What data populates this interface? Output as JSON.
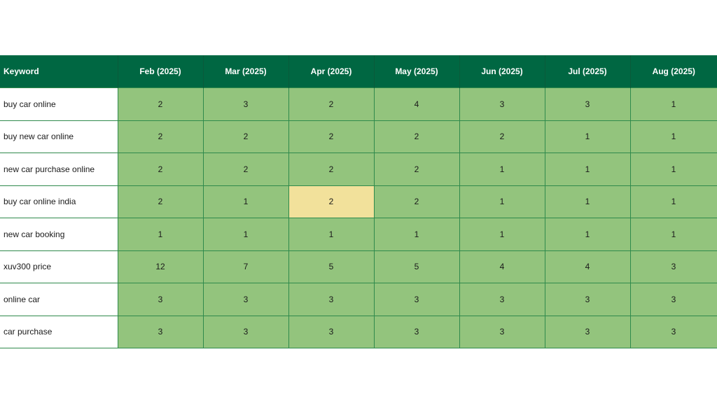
{
  "table": {
    "headers": [
      "Keyword",
      "Feb (2025)",
      "Mar (2025)",
      "Apr (2025)",
      "May (2025)",
      "Jun (2025)",
      "Jul (2025)",
      "Aug (2025)"
    ],
    "rows": [
      {
        "keyword": "buy car online",
        "values": [
          "2",
          "3",
          "2",
          "4",
          "3",
          "3",
          "1"
        ]
      },
      {
        "keyword": "buy new car online",
        "values": [
          "2",
          "2",
          "2",
          "2",
          "2",
          "1",
          "1"
        ]
      },
      {
        "keyword": "new car purchase online",
        "values": [
          "2",
          "2",
          "2",
          "2",
          "1",
          "1",
          "1"
        ]
      },
      {
        "keyword": "buy car online india",
        "values": [
          "2",
          "1",
          "2",
          "2",
          "1",
          "1",
          "1"
        ]
      },
      {
        "keyword": "new car booking",
        "values": [
          "1",
          "1",
          "1",
          "1",
          "1",
          "1",
          "1"
        ]
      },
      {
        "keyword": "xuv300 price",
        "values": [
          "12",
          "7",
          "5",
          "5",
          "4",
          "4",
          "3"
        ]
      },
      {
        "keyword": "online car",
        "values": [
          "3",
          "3",
          "3",
          "3",
          "3",
          "3",
          "3"
        ]
      },
      {
        "keyword": "car purchase",
        "values": [
          "3",
          "3",
          "3",
          "3",
          "3",
          "3",
          "3"
        ]
      }
    ]
  },
  "colors": {
    "header_bg": "#006742",
    "cell_bg": "#93c47d",
    "highlight_bg": "#f2e19b",
    "keyword_bg": "#ffffff"
  }
}
